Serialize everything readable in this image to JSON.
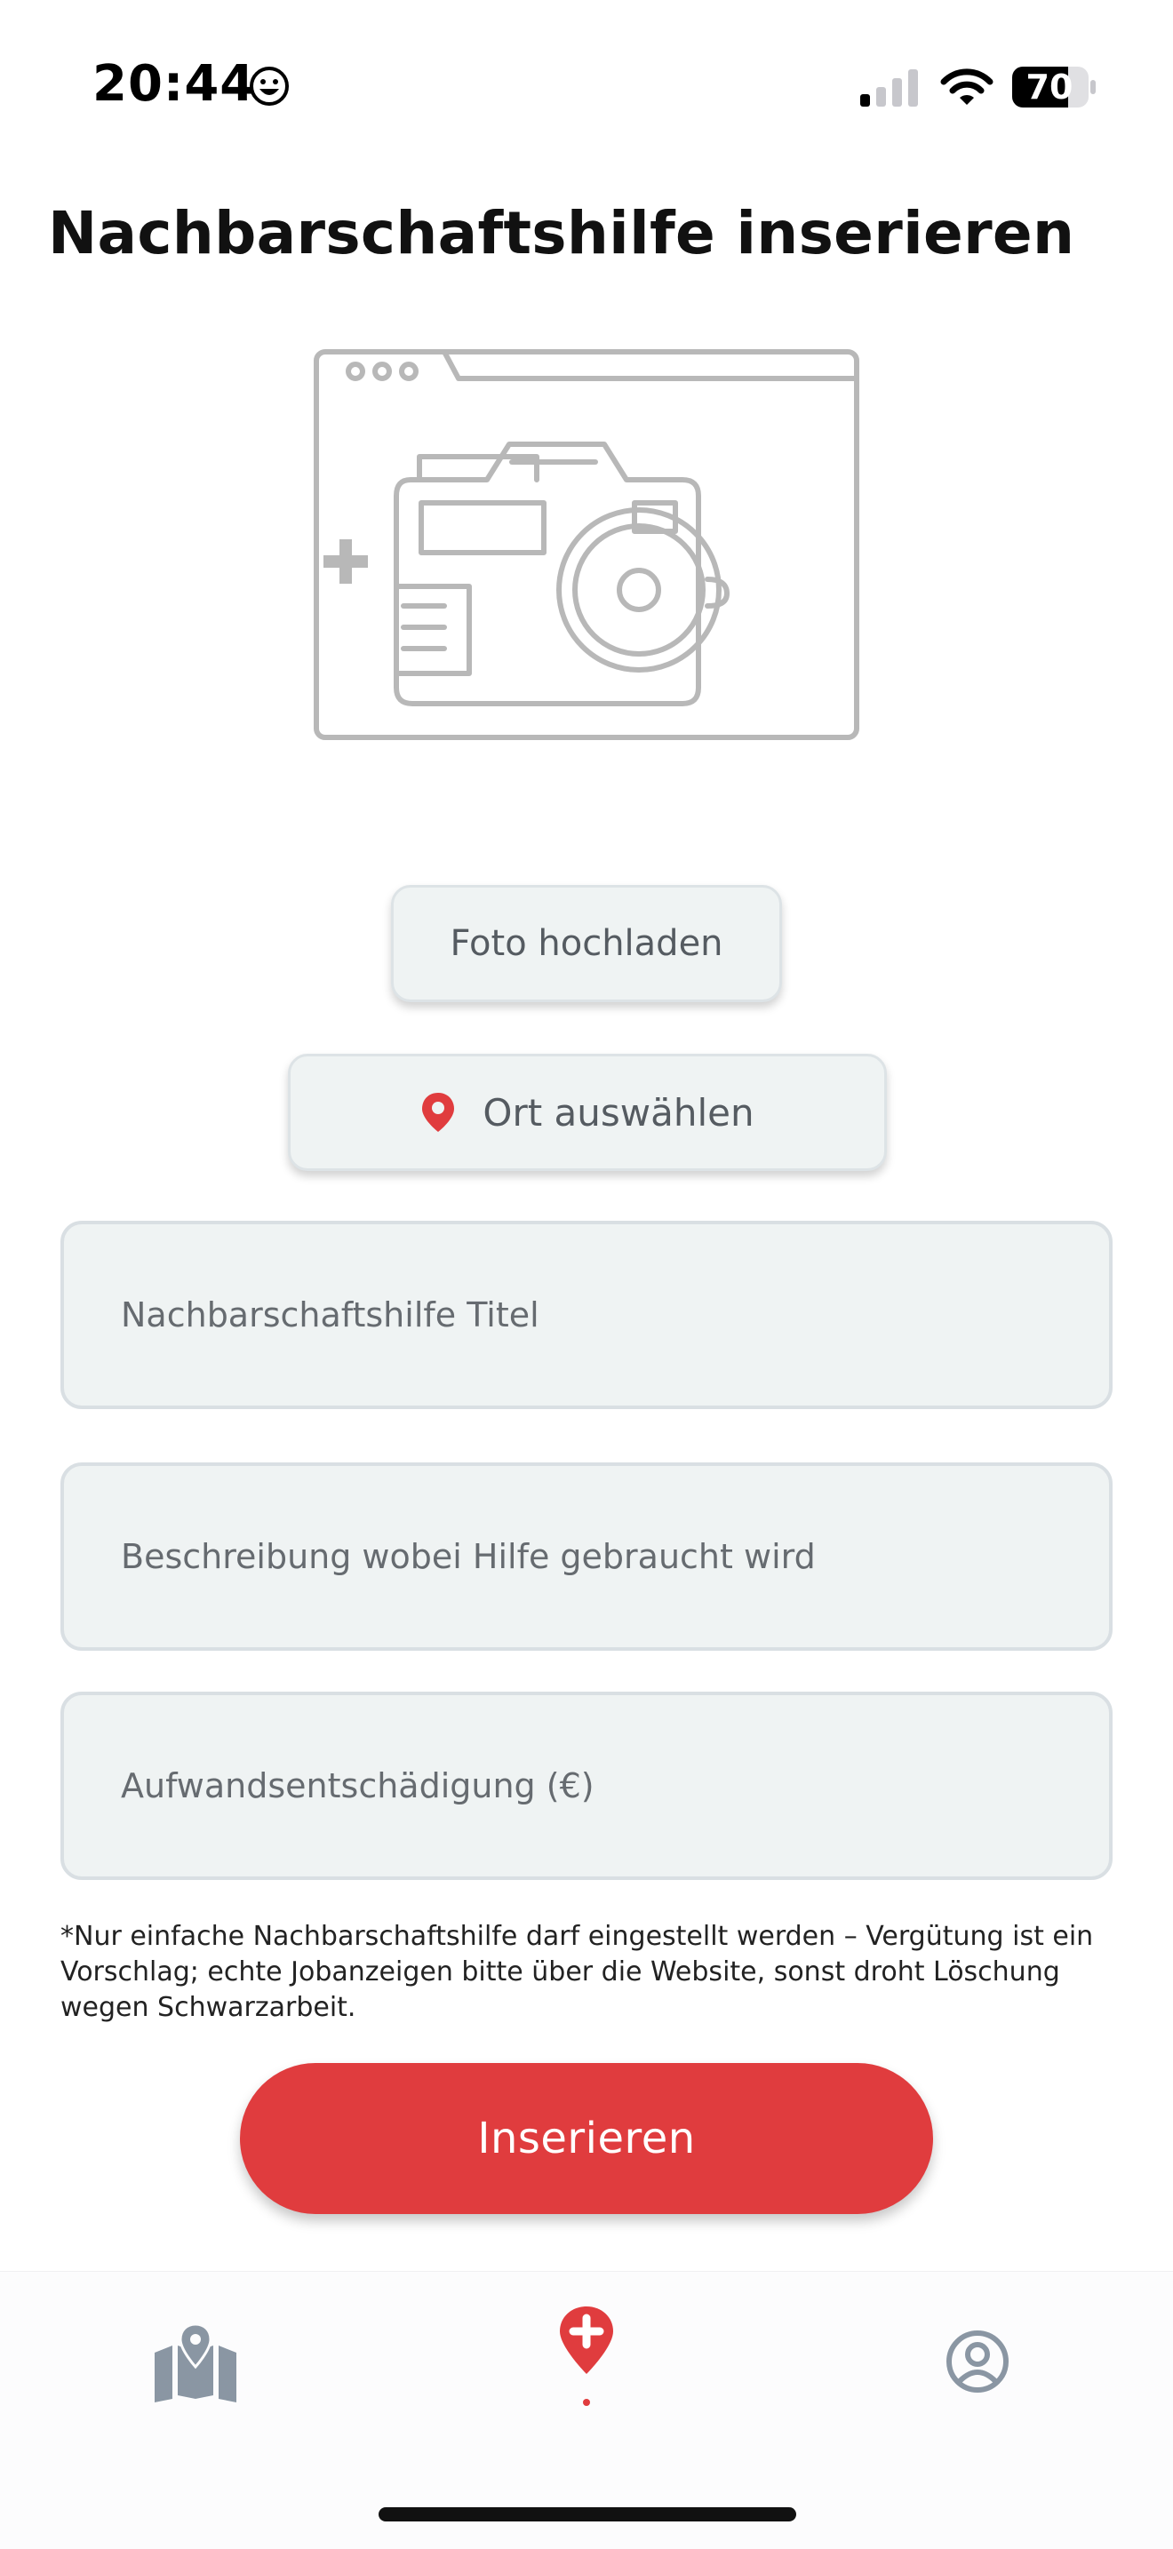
{
  "status_bar": {
    "time": "20:44",
    "battery": "70",
    "icons": [
      "smiley-icon",
      "cellular-signal-icon",
      "wifi-icon",
      "battery-icon"
    ]
  },
  "page": {
    "title": "Nachbarschaftshilfe inserieren"
  },
  "photo": {
    "illustration_icon": "camera-browser-add-icon",
    "upload_label": "Foto hochladen"
  },
  "location": {
    "select_label": "Ort auswählen",
    "icon": "location-pin-icon"
  },
  "form": {
    "title_placeholder": "Nachbarschaftshilfe Titel",
    "description_placeholder": "Beschreibung wobei Hilfe gebraucht wird",
    "fee_placeholder": "Aufwandsentschädigung (€)"
  },
  "note": "*Nur einfache Nachbarschaftshilfe darf eingestellt werden – Vergütung ist ein Vorschlag; echte Jobanzeigen bitte über die Website, sonst droht Löschung wegen Schwarzarbeit.",
  "submit_label": "Inserieren",
  "tab_bar": {
    "items": [
      {
        "icon": "map-icon",
        "active": false
      },
      {
        "icon": "add-location-icon",
        "active": true
      },
      {
        "icon": "profile-icon",
        "active": false
      }
    ]
  },
  "colors": {
    "accent": "#e03c3e",
    "field_background": "#eff3f3",
    "tab_inactive": "#8a96a3",
    "illustration_stroke": "#b8b8b8"
  }
}
